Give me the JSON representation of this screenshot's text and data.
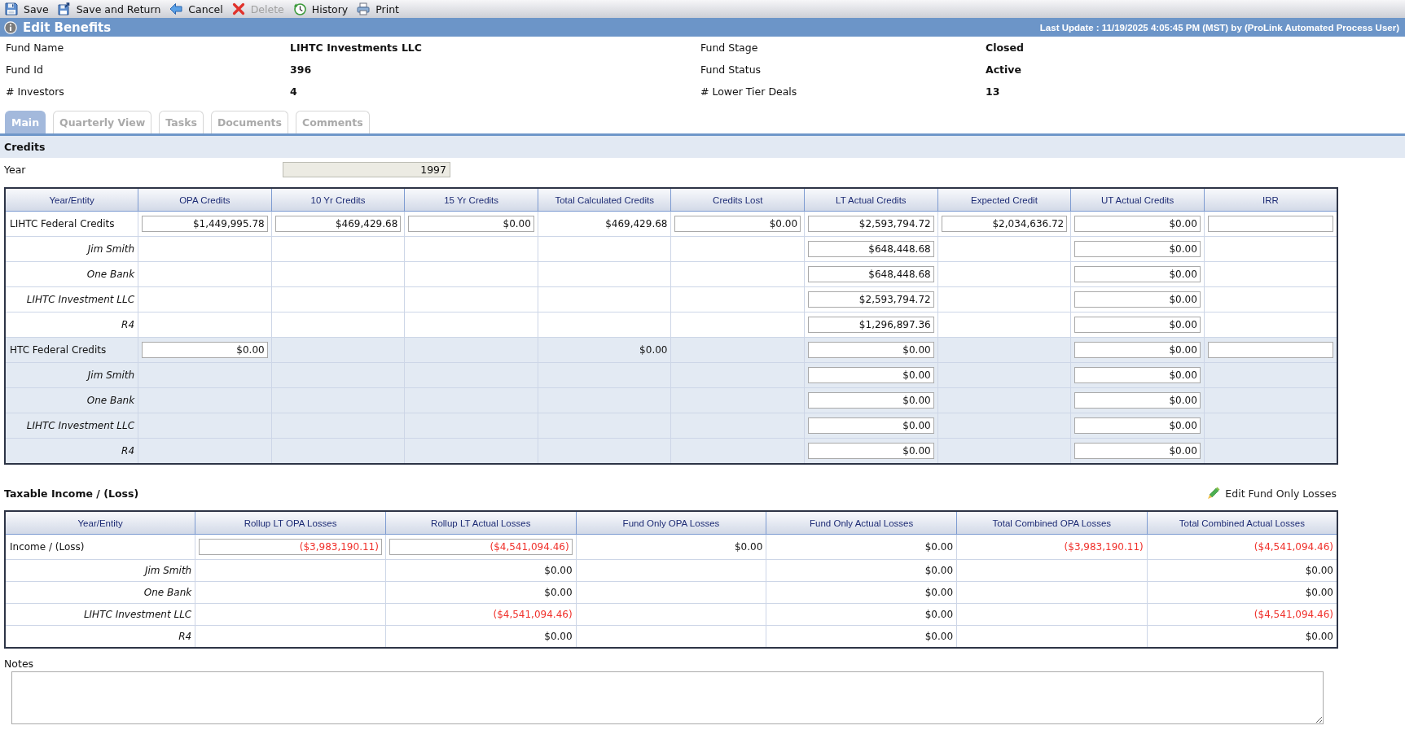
{
  "toolbar": [
    {
      "label": "Save",
      "disabled": false
    },
    {
      "label": "Save and Return",
      "disabled": false
    },
    {
      "label": "Cancel",
      "disabled": false
    },
    {
      "label": "Delete",
      "disabled": true
    },
    {
      "label": "History",
      "disabled": false
    },
    {
      "label": "Print",
      "disabled": false
    }
  ],
  "header": {
    "title": "Edit Benefits",
    "last_update": "Last Update : 11/19/2025 4:05:45 PM (MST) by (ProLink Automated Process User)"
  },
  "fund_fields": [
    {
      "label": "Fund Name",
      "value": "LIHTC Investments LLC"
    },
    {
      "label": "Fund Stage",
      "value": "Closed"
    },
    {
      "label": "Fund Id",
      "value": "396"
    },
    {
      "label": "Fund Status",
      "value": "Active"
    },
    {
      "label": "# Investors",
      "value": "4"
    },
    {
      "label": "# Lower Tier Deals",
      "value": "13"
    }
  ],
  "tabs": [
    {
      "label": "Main",
      "selected": true
    },
    {
      "label": "Quarterly View",
      "selected": false
    },
    {
      "label": "Tasks",
      "selected": false
    },
    {
      "label": "Documents",
      "selected": false
    },
    {
      "label": "Comments",
      "selected": false
    }
  ],
  "credits": {
    "title": "Credits",
    "year": {
      "label": "Year",
      "value": "1997",
      "disabled": true
    },
    "table": {
      "entity_header": "Year/Entity",
      "columns": [
        "OPA Credits",
        "10 Yr Credits",
        "15 Yr Credits",
        "Total Calculated Credits",
        "Credits Lost",
        "LT Actual Credits",
        "Expected Credit",
        "UT Actual Credits",
        "IRR"
      ],
      "rows": [
        {
          "entity": "LIHTC Federal Credits",
          "cells": [
            {
              "kind": "input",
              "value": "$1,449,995.78"
            },
            {
              "kind": "input",
              "value": "$469,429.68"
            },
            {
              "kind": "input",
              "value": "$0.00"
            },
            {
              "kind": "text",
              "value": "$469,429.68"
            },
            {
              "kind": "input",
              "value": "$0.00"
            },
            {
              "kind": "input",
              "value": "$2,593,794.72"
            },
            {
              "kind": "input",
              "value": "$2,034,636.72"
            },
            {
              "kind": "input",
              "value": "$0.00"
            },
            {
              "kind": "input"
            }
          ],
          "children": [
            {
              "entity": "Jim Smith",
              "cells": [
                null,
                null,
                null,
                null,
                null,
                {
                  "kind": "input",
                  "value": "$648,448.68"
                },
                null,
                {
                  "kind": "input",
                  "value": "$0.00"
                },
                null
              ]
            },
            {
              "entity": "One Bank",
              "cells": [
                null,
                null,
                null,
                null,
                null,
                {
                  "kind": "input",
                  "value": "$648,448.68"
                },
                null,
                {
                  "kind": "input",
                  "value": "$0.00"
                },
                null
              ]
            },
            {
              "entity": "LIHTC Investment LLC",
              "cells": [
                null,
                null,
                null,
                null,
                null,
                {
                  "kind": "input",
                  "value": "$2,593,794.72"
                },
                null,
                {
                  "kind": "input",
                  "value": "$0.00"
                },
                null
              ]
            },
            {
              "entity": "R4",
              "cells": [
                null,
                null,
                null,
                null,
                null,
                {
                  "kind": "input",
                  "value": "$1,296,897.36"
                },
                null,
                {
                  "kind": "input",
                  "value": "$0.00"
                },
                null
              ]
            }
          ]
        },
        {
          "entity": "HTC Federal Credits",
          "cells": [
            {
              "kind": "input",
              "value": "$0.00"
            },
            null,
            null,
            {
              "kind": "text",
              "value": "$0.00"
            },
            null,
            {
              "kind": "input",
              "value": "$0.00"
            },
            null,
            {
              "kind": "input",
              "value": "$0.00"
            },
            {
              "kind": "input"
            }
          ],
          "children": [
            {
              "entity": "Jim Smith",
              "cells": [
                null,
                null,
                null,
                null,
                null,
                {
                  "kind": "input",
                  "value": "$0.00"
                },
                null,
                {
                  "kind": "input",
                  "value": "$0.00"
                },
                null
              ]
            },
            {
              "entity": "One Bank",
              "cells": [
                null,
                null,
                null,
                null,
                null,
                {
                  "kind": "input",
                  "value": "$0.00"
                },
                null,
                {
                  "kind": "input",
                  "value": "$0.00"
                },
                null
              ]
            },
            {
              "entity": "LIHTC Investment LLC",
              "cells": [
                null,
                null,
                null,
                null,
                null,
                {
                  "kind": "input",
                  "value": "$0.00"
                },
                null,
                {
                  "kind": "input",
                  "value": "$0.00"
                },
                null
              ]
            },
            {
              "entity": "R4",
              "cells": [
                null,
                null,
                null,
                null,
                null,
                {
                  "kind": "input",
                  "value": "$0.00"
                },
                null,
                {
                  "kind": "input",
                  "value": "$0.00"
                },
                null
              ]
            }
          ]
        }
      ]
    }
  },
  "taxable_income": {
    "title": "Taxable Income / (Loss)",
    "edit_link": "Edit Fund Only Losses",
    "table": {
      "entity_header": "Year/Entity",
      "columns": [
        "Rollup LT OPA Losses",
        "Rollup LT Actual Losses",
        "Fund Only OPA Losses",
        "Fund Only Actual Losses",
        "Total Combined OPA Losses",
        "Total Combined Actual Losses"
      ],
      "rows": [
        {
          "entity": "Income / (Loss)",
          "cells": [
            {
              "kind": "input",
              "value": "($3,983,190.11)",
              "negative": true
            },
            {
              "kind": "input",
              "value": "($4,541,094.46)",
              "negative": true
            },
            {
              "kind": "text",
              "value": "$0.00",
              "negative": false
            },
            {
              "kind": "text",
              "value": "$0.00",
              "negative": false
            },
            {
              "kind": "text",
              "value": "($3,983,190.11)",
              "negative": true
            },
            {
              "kind": "text",
              "value": "($4,541,094.46)",
              "negative": true
            }
          ],
          "children": [
            {
              "entity": "Jim Smith",
              "cells": [
                null,
                {
                  "kind": "text",
                  "value": "$0.00",
                  "negative": false
                },
                null,
                {
                  "kind": "text",
                  "value": "$0.00",
                  "negative": false
                },
                null,
                {
                  "kind": "text",
                  "value": "$0.00",
                  "negative": false
                }
              ]
            },
            {
              "entity": "One Bank",
              "cells": [
                null,
                {
                  "kind": "text",
                  "value": "$0.00",
                  "negative": false
                },
                null,
                {
                  "kind": "text",
                  "value": "$0.00",
                  "negative": false
                },
                null,
                {
                  "kind": "text",
                  "value": "$0.00",
                  "negative": false
                }
              ]
            },
            {
              "entity": "LIHTC Investment LLC",
              "cells": [
                null,
                {
                  "kind": "text",
                  "value": "($4,541,094.46)",
                  "negative": true
                },
                null,
                {
                  "kind": "text",
                  "value": "$0.00",
                  "negative": false
                },
                null,
                {
                  "kind": "text",
                  "value": "($4,541,094.46)",
                  "negative": true
                }
              ]
            },
            {
              "entity": "R4",
              "cells": [
                null,
                {
                  "kind": "text",
                  "value": "$0.00",
                  "negative": false
                },
                null,
                {
                  "kind": "text",
                  "value": "$0.00",
                  "negative": false
                },
                null,
                {
                  "kind": "text",
                  "value": "$0.00",
                  "negative": false
                }
              ]
            }
          ]
        }
      ]
    }
  },
  "notes": {
    "label": "Notes"
  }
}
